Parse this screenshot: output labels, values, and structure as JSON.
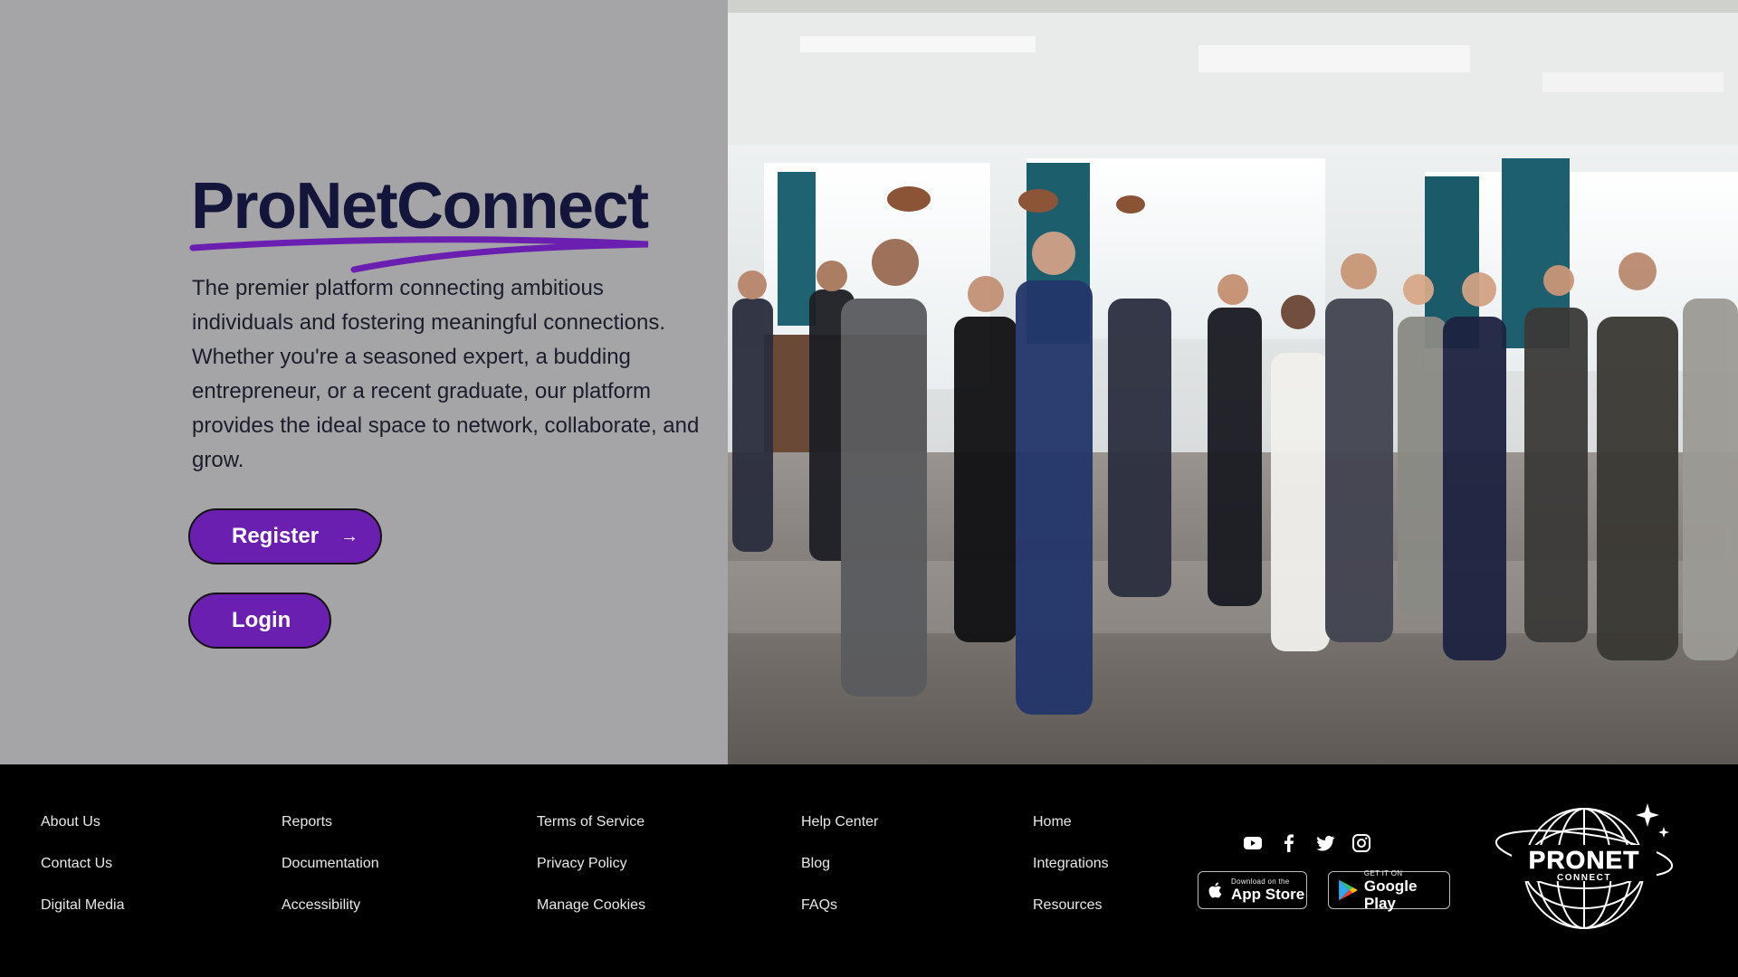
{
  "hero": {
    "brand": "ProNetConnect",
    "tagline": "The premier platform connecting ambitious individuals and fostering meaningful connections. Whether you're a seasoned expert, a budding entrepreneur, or a recent graduate, our platform provides the ideal space to network, collaborate, and grow.",
    "register_label": "Register",
    "register_icon": "arrow-right-icon",
    "login_label": "Login",
    "photo_icon": "networking-event-photo"
  },
  "footer": {
    "columns": [
      [
        "About Us",
        "Contact Us",
        "Digital Media"
      ],
      [
        "Reports",
        "Documentation",
        "Accessibility"
      ],
      [
        "Terms of Service",
        "Privacy Policy",
        "Manage Cookies"
      ],
      [
        "Help Center",
        "Blog",
        "FAQs"
      ],
      [
        "Home",
        "Integrations",
        "Resources"
      ]
    ],
    "social_icons": [
      "youtube-icon",
      "facebook-icon",
      "twitter-icon",
      "instagram-icon"
    ],
    "app_store": {
      "small": "Download on the",
      "big": "App Store"
    },
    "google_play": {
      "small": "GET IT ON",
      "big": "Google Play"
    },
    "logo_text": "PRONET",
    "logo_subtext": "CONNECT"
  },
  "colors": {
    "left_panel": "#a5a5a7",
    "brand_text": "#13163a",
    "accent_purple": "#6b1fb0",
    "footer_bg": "#000000"
  }
}
